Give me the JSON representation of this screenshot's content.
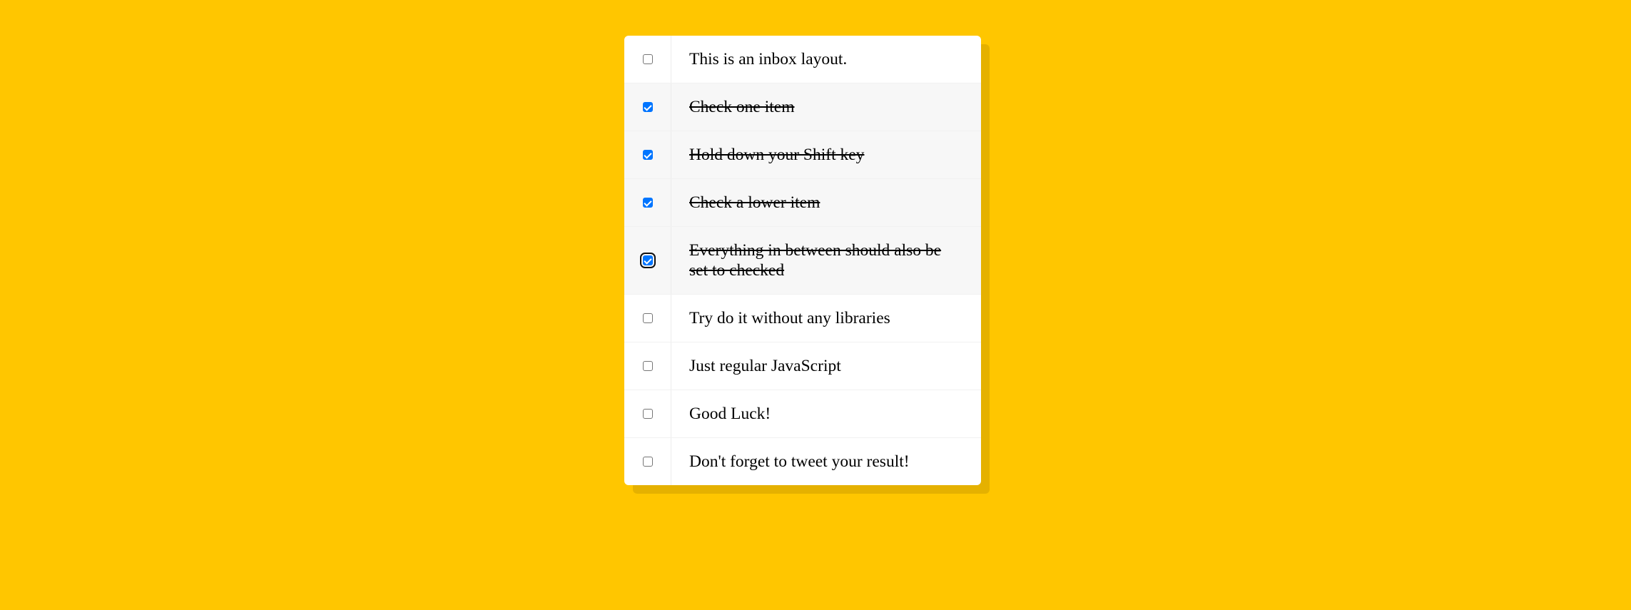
{
  "colors": {
    "background": "#ffc600",
    "card": "#ffffff",
    "checked_row": "#f7f7f7",
    "checkbox_checked": "#0075ff"
  },
  "icons": {
    "unchecked": "checkbox-empty-icon",
    "checked": "checkbox-checked-icon"
  },
  "items": [
    {
      "label": "This is an inbox layout.",
      "checked": false
    },
    {
      "label": "Check one item",
      "checked": true
    },
    {
      "label": "Hold down your Shift key",
      "checked": true
    },
    {
      "label": "Check a lower item",
      "checked": true
    },
    {
      "label": "Everything in between should also be set to checked",
      "checked": true,
      "focused": true
    },
    {
      "label": "Try do it without any libraries",
      "checked": false
    },
    {
      "label": "Just regular JavaScript",
      "checked": false
    },
    {
      "label": "Good Luck!",
      "checked": false
    },
    {
      "label": "Don't forget to tweet your result!",
      "checked": false
    }
  ]
}
